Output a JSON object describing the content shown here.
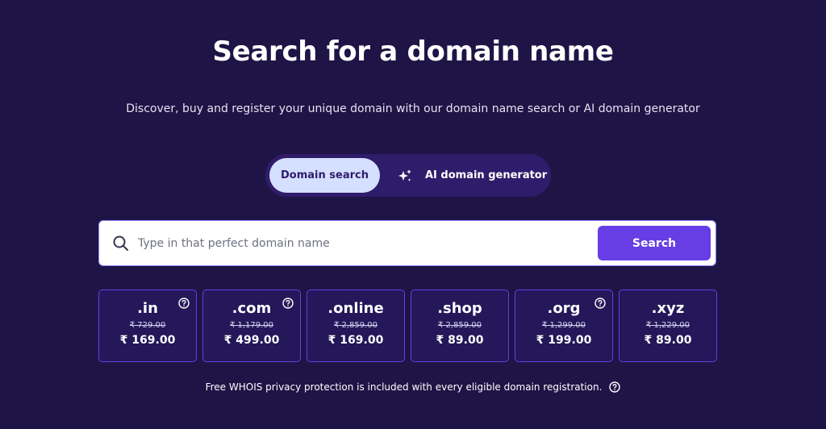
{
  "hero": {
    "title": "Search for a domain name",
    "subtitle": "Discover, buy and register your unique domain with our domain name search or AI domain generator"
  },
  "mode_toggle": {
    "domain_search_label": "Domain search",
    "ai_generator_label": "AI domain generator",
    "active": "Domain search"
  },
  "search": {
    "placeholder": "Type in that perfect domain name",
    "value": "",
    "button_label": "Search"
  },
  "tlds": [
    {
      "name": ".in",
      "old_price": "₹ 729.00",
      "price": "₹ 169.00",
      "has_help": true
    },
    {
      "name": ".com",
      "old_price": "₹ 1,179.00",
      "price": "₹ 499.00",
      "has_help": true
    },
    {
      "name": ".online",
      "old_price": "₹ 2,859.00",
      "price": "₹ 169.00",
      "has_help": false
    },
    {
      "name": ".shop",
      "old_price": "₹ 2,859.00",
      "price": "₹ 89.00",
      "has_help": false
    },
    {
      "name": ".org",
      "old_price": "₹ 1,299.00",
      "price": "₹ 199.00",
      "has_help": true
    },
    {
      "name": ".xyz",
      "old_price": "₹ 1,229.00",
      "price": "₹ 89.00",
      "has_help": false
    }
  ],
  "footer": {
    "note": "Free WHOIS privacy protection is included with every eligible domain registration."
  },
  "colors": {
    "background": "#1f1446",
    "accent": "#673de6",
    "toggle_bg": "#2f1c6a",
    "active_tab": "#d5dfff",
    "card_bg": "#24175a"
  },
  "icons": {
    "search": "search-icon",
    "sparkle": "sparkle-icon",
    "help": "help-circle-icon"
  }
}
